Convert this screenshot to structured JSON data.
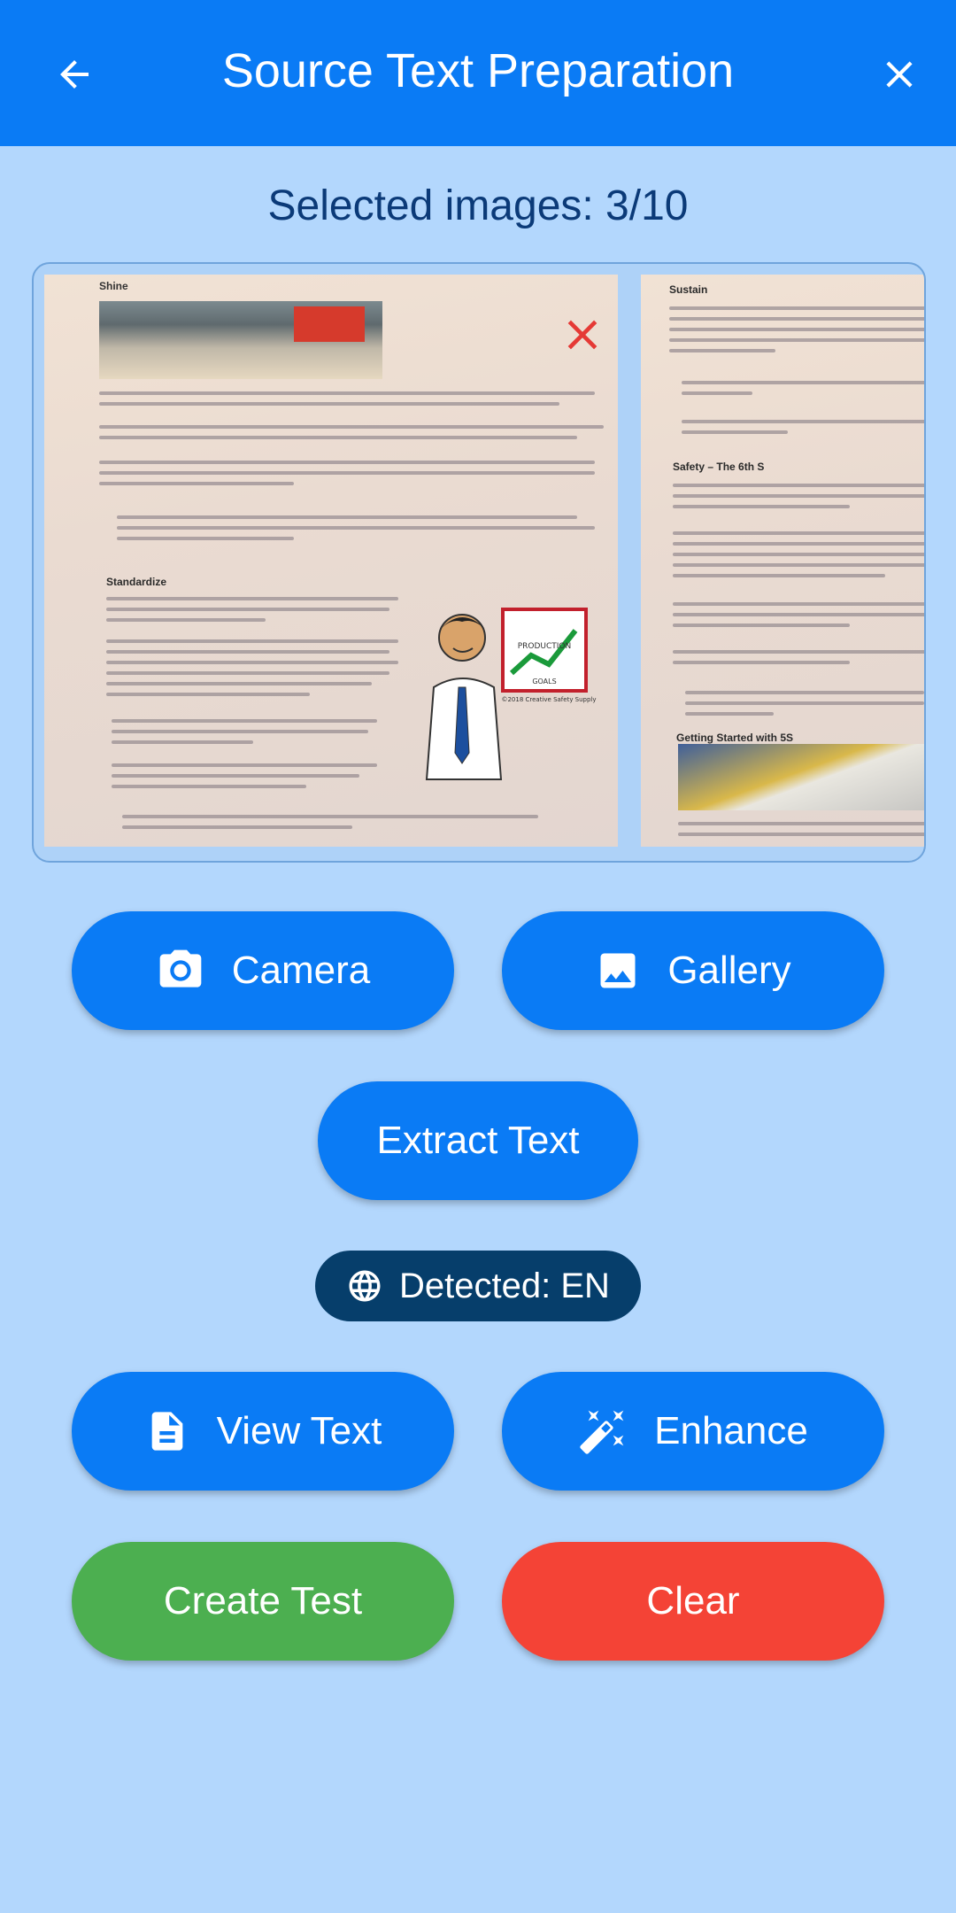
{
  "appbar": {
    "title": "Source Text Preparation",
    "back_icon": "arrow-left-icon",
    "close_icon": "close-icon",
    "color": "#0a7bf5"
  },
  "selection": {
    "label": "Selected images: 3/10"
  },
  "images": [
    {
      "section_top": "Shine",
      "section_mid": "Standardize",
      "cartoon_caption": "PRODUCTION",
      "cartoon_sub": "GOALS",
      "copyright": "©2018 Creative Safety Supply",
      "remove_icon": "close-icon"
    },
    {
      "section_top": "Sustain",
      "section_mid": "Safety – The 6th S",
      "section_bottom": "Getting Started with 5S"
    }
  ],
  "buttons": {
    "camera": "Camera",
    "gallery": "Gallery",
    "extract": "Extract Text",
    "view_text": "View Text",
    "enhance": "Enhance",
    "create_test": "Create Test",
    "clear": "Clear"
  },
  "language_chip": {
    "label": "Detected: EN",
    "icon": "globe-icon"
  },
  "colors": {
    "background": "#b3d7fd",
    "primary": "#0a7bf5",
    "success": "#4caf50",
    "danger": "#f44336",
    "chip": "#063e6b"
  }
}
